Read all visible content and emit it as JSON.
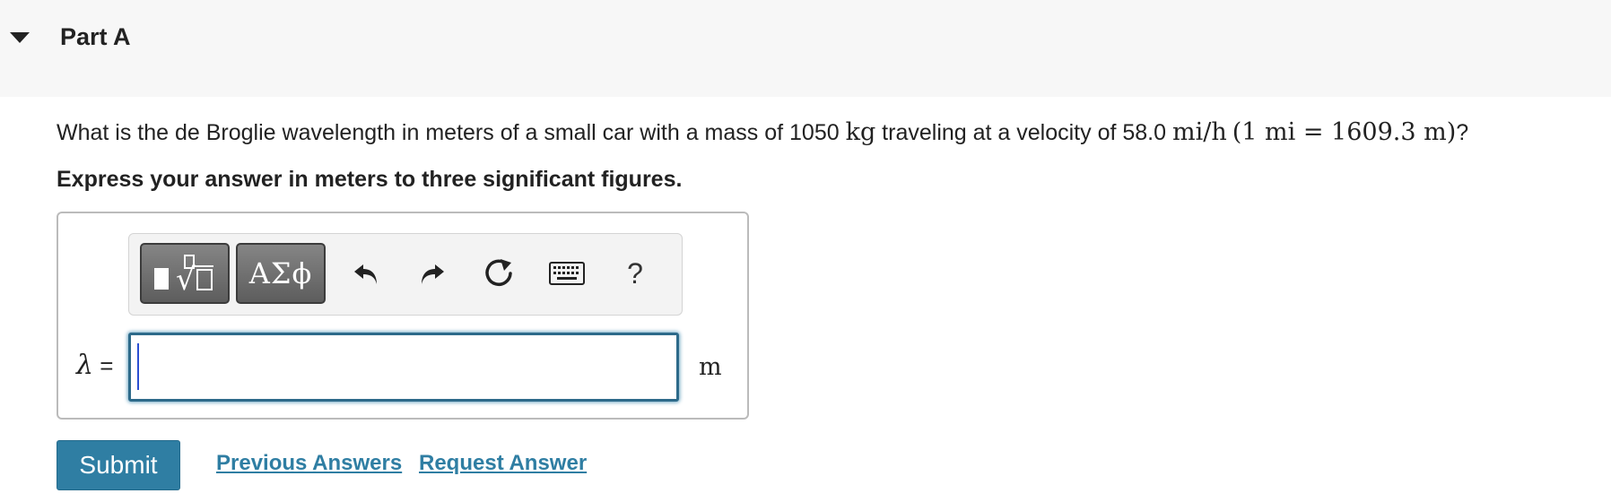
{
  "part": {
    "title": "Part A"
  },
  "question": {
    "text_before": "What is the de Broglie wavelength in meters of a small car with a mass of 1050 ",
    "mass_unit": "kg",
    "text_middle": " traveling at a velocity of 58.0 ",
    "velocity_unit": "mi/h",
    "conversion": "(1 mi = 1609.3 m)",
    "text_end": "?"
  },
  "instruction": "Express your answer in meters to three significant figures.",
  "toolbar": {
    "symbols_label": "ΑΣϕ",
    "help_label": "?",
    "icons": [
      "templates-icon",
      "undo-icon",
      "redo-icon",
      "reset-icon",
      "keyboard-icon",
      "help-icon"
    ]
  },
  "answer": {
    "variable": "λ",
    "equals": " =",
    "value": "",
    "unit": "m"
  },
  "actions": {
    "submit_label": "Submit",
    "previous_answers_label": "Previous Answers",
    "request_answer_label": "Request Answer"
  },
  "colors": {
    "accent": "#2f7ea3",
    "header_bg": "#f7f7f7",
    "input_border": "#2d6a8a"
  }
}
